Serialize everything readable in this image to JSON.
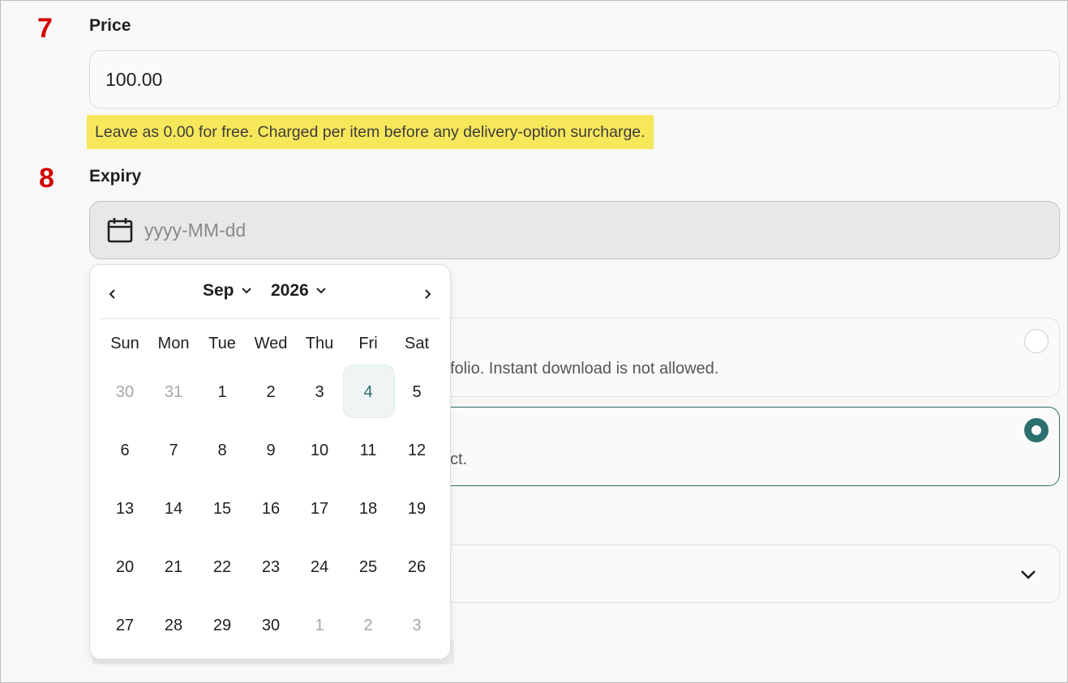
{
  "steps": {
    "price_num": "7",
    "expiry_num": "8"
  },
  "price": {
    "label": "Price",
    "value": "100.00",
    "hint": "Leave as 0.00 for free. Charged per item before any delivery-option surcharge."
  },
  "expiry": {
    "label": "Expiry",
    "placeholder": "yyyy-MM-dd"
  },
  "options": {
    "card1_text": "folio. Instant download is not allowed.",
    "card2_text": "ct."
  },
  "calendar": {
    "month": "Sep",
    "year": "2026",
    "weekdays": [
      "Sun",
      "Mon",
      "Tue",
      "Wed",
      "Thu",
      "Fri",
      "Sat"
    ],
    "days": [
      [
        "30",
        "31",
        "1",
        "2",
        "3",
        "4",
        "5"
      ],
      [
        "6",
        "7",
        "8",
        "9",
        "10",
        "11",
        "12"
      ],
      [
        "13",
        "14",
        "15",
        "16",
        "17",
        "18",
        "19"
      ],
      [
        "20",
        "21",
        "22",
        "23",
        "24",
        "25",
        "26"
      ],
      [
        "27",
        "28",
        "29",
        "30",
        "1",
        "2",
        "3"
      ]
    ]
  },
  "colors": {
    "step_number": "#d40000",
    "hint_highlight": "#f7e75a",
    "accent": "#2c6f6f"
  }
}
